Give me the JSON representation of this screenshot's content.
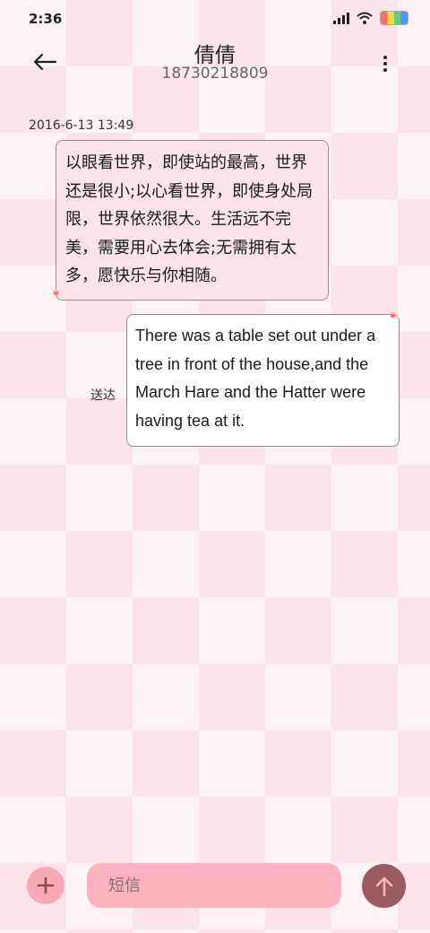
{
  "status_bar": {
    "time": "2:36",
    "icons": [
      "signal-icon",
      "wifi-icon",
      "battery-icon"
    ]
  },
  "header": {
    "back_icon": "arrow-left-icon",
    "contact_name": "倩倩",
    "contact_number": "18730218809",
    "more_icon": "more-vertical-icon"
  },
  "conversation": {
    "timestamp": "2016-6-13 13:49",
    "incoming_message": "以眼看世界，即使站的最高，世界还是很小;以心看世界，即使身处局限，世界依然很大。生活远不完美，需要用心去体会;无需拥有太多，愿快乐与你相随。",
    "outgoing_message": "There was a table set out under a tree in front of the house,and the March Hare and the Hatter were having tea at it.",
    "outgoing_status": "送达"
  },
  "composer": {
    "add_icon": "plus-icon",
    "input_placeholder": "短信",
    "input_value": "",
    "send_icon": "arrow-up-icon"
  },
  "colors": {
    "background_light": "#fdf3f6",
    "background_check": "#fde3ea",
    "incoming_bubble": "#fde4ea",
    "outgoing_bubble": "#ffffff",
    "add_button": "#f9a8b8",
    "input_bg": "#fbb3c0",
    "send_button": "#9a5a61"
  }
}
